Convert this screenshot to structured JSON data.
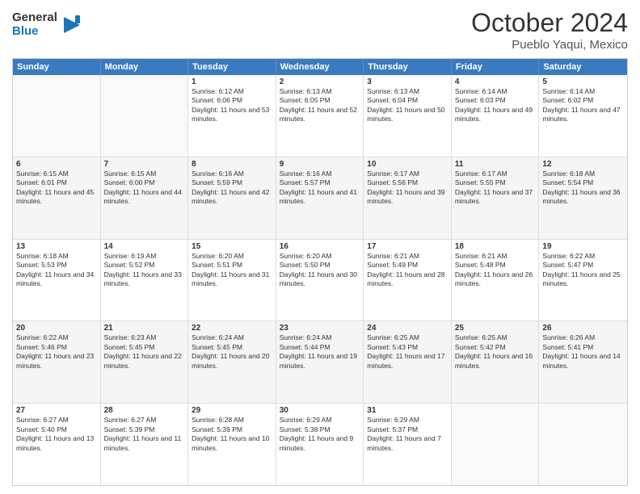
{
  "logo": {
    "general": "General",
    "blue": "Blue",
    "icon": "▶"
  },
  "header": {
    "month": "October 2024",
    "location": "Pueblo Yaqui, Mexico"
  },
  "weekdays": [
    "Sunday",
    "Monday",
    "Tuesday",
    "Wednesday",
    "Thursday",
    "Friday",
    "Saturday"
  ],
  "rows": [
    [
      {
        "day": "",
        "sunrise": "",
        "sunset": "",
        "daylight": "",
        "empty": true
      },
      {
        "day": "",
        "sunrise": "",
        "sunset": "",
        "daylight": "",
        "empty": true
      },
      {
        "day": "1",
        "sunrise": "Sunrise: 6:12 AM",
        "sunset": "Sunset: 6:06 PM",
        "daylight": "Daylight: 11 hours and 53 minutes."
      },
      {
        "day": "2",
        "sunrise": "Sunrise: 6:13 AM",
        "sunset": "Sunset: 6:05 PM",
        "daylight": "Daylight: 11 hours and 52 minutes."
      },
      {
        "day": "3",
        "sunrise": "Sunrise: 6:13 AM",
        "sunset": "Sunset: 6:04 PM",
        "daylight": "Daylight: 11 hours and 50 minutes."
      },
      {
        "day": "4",
        "sunrise": "Sunrise: 6:14 AM",
        "sunset": "Sunset: 6:03 PM",
        "daylight": "Daylight: 11 hours and 49 minutes."
      },
      {
        "day": "5",
        "sunrise": "Sunrise: 6:14 AM",
        "sunset": "Sunset: 6:02 PM",
        "daylight": "Daylight: 11 hours and 47 minutes."
      }
    ],
    [
      {
        "day": "6",
        "sunrise": "Sunrise: 6:15 AM",
        "sunset": "Sunset: 6:01 PM",
        "daylight": "Daylight: 11 hours and 45 minutes."
      },
      {
        "day": "7",
        "sunrise": "Sunrise: 6:15 AM",
        "sunset": "Sunset: 6:00 PM",
        "daylight": "Daylight: 11 hours and 44 minutes."
      },
      {
        "day": "8",
        "sunrise": "Sunrise: 6:16 AM",
        "sunset": "Sunset: 5:59 PM",
        "daylight": "Daylight: 11 hours and 42 minutes."
      },
      {
        "day": "9",
        "sunrise": "Sunrise: 6:16 AM",
        "sunset": "Sunset: 5:57 PM",
        "daylight": "Daylight: 11 hours and 41 minutes."
      },
      {
        "day": "10",
        "sunrise": "Sunrise: 6:17 AM",
        "sunset": "Sunset: 5:56 PM",
        "daylight": "Daylight: 11 hours and 39 minutes."
      },
      {
        "day": "11",
        "sunrise": "Sunrise: 6:17 AM",
        "sunset": "Sunset: 5:55 PM",
        "daylight": "Daylight: 11 hours and 37 minutes."
      },
      {
        "day": "12",
        "sunrise": "Sunrise: 6:18 AM",
        "sunset": "Sunset: 5:54 PM",
        "daylight": "Daylight: 11 hours and 36 minutes."
      }
    ],
    [
      {
        "day": "13",
        "sunrise": "Sunrise: 6:18 AM",
        "sunset": "Sunset: 5:53 PM",
        "daylight": "Daylight: 11 hours and 34 minutes."
      },
      {
        "day": "14",
        "sunrise": "Sunrise: 6:19 AM",
        "sunset": "Sunset: 5:52 PM",
        "daylight": "Daylight: 11 hours and 33 minutes."
      },
      {
        "day": "15",
        "sunrise": "Sunrise: 6:20 AM",
        "sunset": "Sunset: 5:51 PM",
        "daylight": "Daylight: 11 hours and 31 minutes."
      },
      {
        "day": "16",
        "sunrise": "Sunrise: 6:20 AM",
        "sunset": "Sunset: 5:50 PM",
        "daylight": "Daylight: 11 hours and 30 minutes."
      },
      {
        "day": "17",
        "sunrise": "Sunrise: 6:21 AM",
        "sunset": "Sunset: 5:49 PM",
        "daylight": "Daylight: 11 hours and 28 minutes."
      },
      {
        "day": "18",
        "sunrise": "Sunrise: 6:21 AM",
        "sunset": "Sunset: 5:48 PM",
        "daylight": "Daylight: 11 hours and 26 minutes."
      },
      {
        "day": "19",
        "sunrise": "Sunrise: 6:22 AM",
        "sunset": "Sunset: 5:47 PM",
        "daylight": "Daylight: 11 hours and 25 minutes."
      }
    ],
    [
      {
        "day": "20",
        "sunrise": "Sunrise: 6:22 AM",
        "sunset": "Sunset: 5:46 PM",
        "daylight": "Daylight: 11 hours and 23 minutes."
      },
      {
        "day": "21",
        "sunrise": "Sunrise: 6:23 AM",
        "sunset": "Sunset: 5:45 PM",
        "daylight": "Daylight: 11 hours and 22 minutes."
      },
      {
        "day": "22",
        "sunrise": "Sunrise: 6:24 AM",
        "sunset": "Sunset: 5:45 PM",
        "daylight": "Daylight: 11 hours and 20 minutes."
      },
      {
        "day": "23",
        "sunrise": "Sunrise: 6:24 AM",
        "sunset": "Sunset: 5:44 PM",
        "daylight": "Daylight: 11 hours and 19 minutes."
      },
      {
        "day": "24",
        "sunrise": "Sunrise: 6:25 AM",
        "sunset": "Sunset: 5:43 PM",
        "daylight": "Daylight: 11 hours and 17 minutes."
      },
      {
        "day": "25",
        "sunrise": "Sunrise: 6:25 AM",
        "sunset": "Sunset: 5:42 PM",
        "daylight": "Daylight: 11 hours and 16 minutes."
      },
      {
        "day": "26",
        "sunrise": "Sunrise: 6:26 AM",
        "sunset": "Sunset: 5:41 PM",
        "daylight": "Daylight: 11 hours and 14 minutes."
      }
    ],
    [
      {
        "day": "27",
        "sunrise": "Sunrise: 6:27 AM",
        "sunset": "Sunset: 5:40 PM",
        "daylight": "Daylight: 11 hours and 13 minutes."
      },
      {
        "day": "28",
        "sunrise": "Sunrise: 6:27 AM",
        "sunset": "Sunset: 5:39 PM",
        "daylight": "Daylight: 11 hours and 11 minutes."
      },
      {
        "day": "29",
        "sunrise": "Sunrise: 6:28 AM",
        "sunset": "Sunset: 5:39 PM",
        "daylight": "Daylight: 11 hours and 10 minutes."
      },
      {
        "day": "30",
        "sunrise": "Sunrise: 6:29 AM",
        "sunset": "Sunset: 5:38 PM",
        "daylight": "Daylight: 11 hours and 9 minutes."
      },
      {
        "day": "31",
        "sunrise": "Sunrise: 6:29 AM",
        "sunset": "Sunset: 5:37 PM",
        "daylight": "Daylight: 11 hours and 7 minutes."
      },
      {
        "day": "",
        "sunrise": "",
        "sunset": "",
        "daylight": "",
        "empty": true
      },
      {
        "day": "",
        "sunrise": "",
        "sunset": "",
        "daylight": "",
        "empty": true
      }
    ]
  ]
}
